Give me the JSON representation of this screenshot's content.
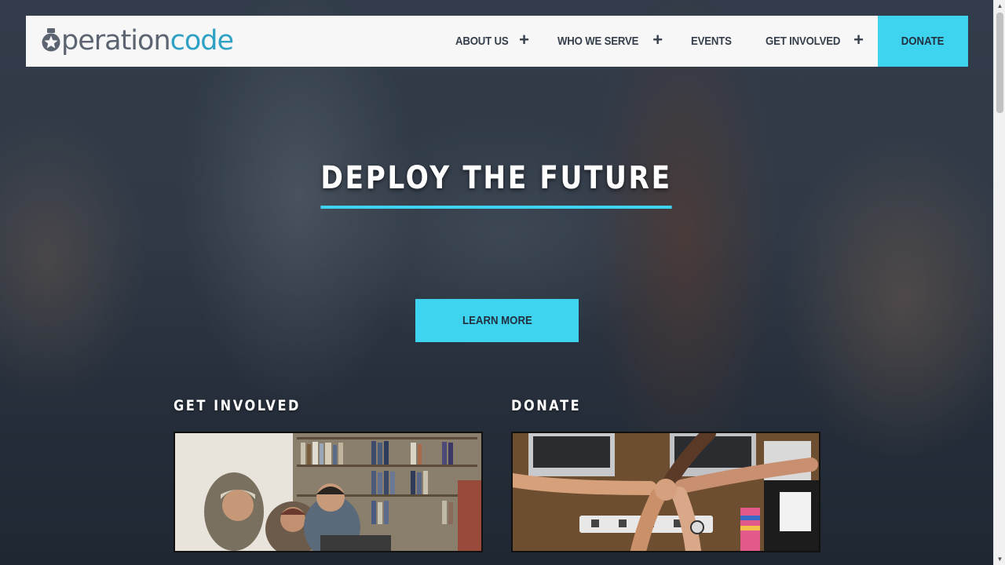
{
  "header": {
    "logo": {
      "text_prefix": "peration",
      "text_suffix": "code"
    },
    "nav": [
      {
        "label": "ABOUT US",
        "has_submenu": true
      },
      {
        "label": "WHO WE SERVE",
        "has_submenu": true
      },
      {
        "label": "EVENTS",
        "has_submenu": false
      },
      {
        "label": "GET INVOLVED",
        "has_submenu": true
      }
    ],
    "donate_label": "DONATE",
    "submenu_symbol": "+"
  },
  "hero": {
    "title": "DEPLOY THE FUTURE",
    "cta_label": "LEARN MORE"
  },
  "sections": {
    "get_involved": {
      "title": "GET INVOLVED",
      "image_alt": "group-of-people-at-laptop"
    },
    "donate": {
      "title": "DONATE",
      "image_alt": "team-fist-bump-over-desk"
    }
  },
  "colors": {
    "accent": "#3ed4f0",
    "nav_text": "#36404c",
    "logo_gray": "#5b6470",
    "logo_blue": "#2ea1c4"
  }
}
